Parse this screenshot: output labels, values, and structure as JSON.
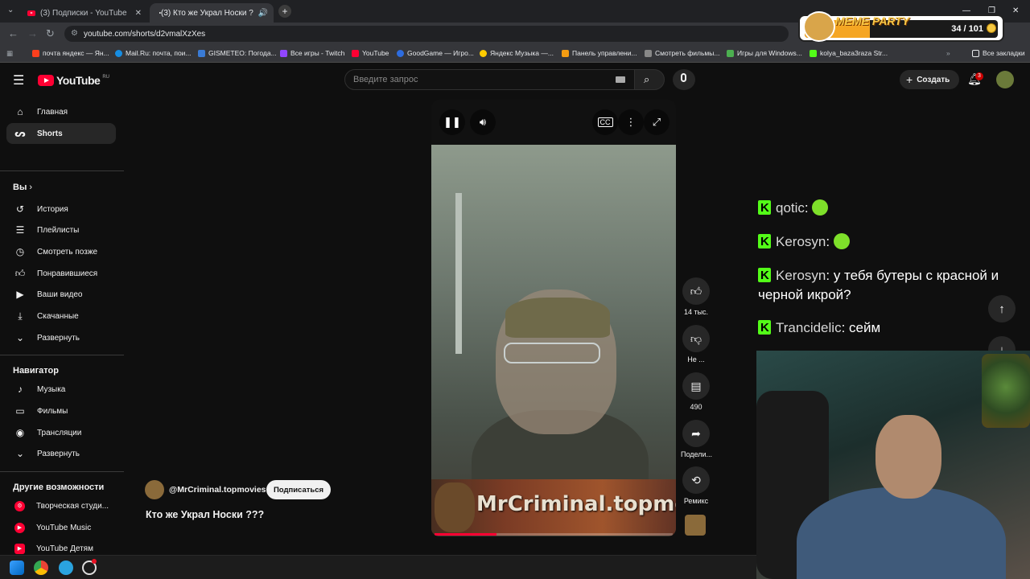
{
  "browser": {
    "tabs": [
      {
        "label": "(3) Подписки - YouTube"
      },
      {
        "label": "(3) Кто же Украл Носки ?"
      }
    ],
    "url": "youtube.com/shorts/d2vmalXzXes",
    "bookmarks": [
      "почта яндекс — Ян...",
      "Mail.Ru: почта, пои...",
      "GISMETEO: Погода...",
      "Все игры - Twitch",
      "YouTube",
      "GoodGame — Игро...",
      "Яндекс Музыка —...",
      "Панель управлени...",
      "Смотреть фильмы...",
      "Игры для Windows...",
      "kolya_baza3raza Str...",
      "Все закладки"
    ]
  },
  "overlay": {
    "title": "MEME PARTY",
    "count": "34 / 101",
    "progress": 0.337
  },
  "youtube": {
    "logo": "YouTube",
    "region": "RU",
    "search_placeholder": "Введите запрос",
    "create_label": "Создать",
    "notifications": "3"
  },
  "sidebar": {
    "main": [
      {
        "label": "Главная",
        "icon": "home-icon"
      },
      {
        "label": "Shorts",
        "icon": "shorts-icon"
      }
    ],
    "you_header": "Вы",
    "you": [
      {
        "label": "История",
        "icon": "history-icon"
      },
      {
        "label": "Плейлисты",
        "icon": "playlist-icon"
      },
      {
        "label": "Смотреть позже",
        "icon": "clock-icon"
      },
      {
        "label": "Понравившиеся",
        "icon": "thumbs-up-icon"
      },
      {
        "label": "Ваши видео",
        "icon": "video-icon"
      },
      {
        "label": "Скачанные",
        "icon": "download-icon"
      },
      {
        "label": "Развернуть",
        "icon": "chevron-down-icon"
      }
    ],
    "nav_header": "Навигатор",
    "nav": [
      {
        "label": "Музыка",
        "icon": "music-icon"
      },
      {
        "label": "Фильмы",
        "icon": "film-icon"
      },
      {
        "label": "Трансляции",
        "icon": "live-icon"
      },
      {
        "label": "Развернуть",
        "icon": "chevron-down-icon"
      }
    ],
    "more_header": "Другие возможности",
    "more": [
      {
        "label": "Творческая студи...",
        "icon": "studio-icon"
      },
      {
        "label": "YouTube Music",
        "icon": "yt-music-icon"
      },
      {
        "label": "YouTube Детям",
        "icon": "yt-kids-icon"
      }
    ]
  },
  "short": {
    "watermark": "MrCriminal.topmovie",
    "channel": "@MrCriminal.topmovies",
    "subscribe_label": "Подписаться",
    "title": "Кто же Украл Носки ???",
    "progress": 0.26,
    "actions": {
      "likes": "14 тыс.",
      "dislike": "Не ...",
      "comments": "490",
      "share": "Подели...",
      "remix": "Ремикс"
    }
  },
  "chat": [
    {
      "user": "qotic",
      "text": ""
    },
    {
      "user": "Kerosyn",
      "text": ""
    },
    {
      "user": "Kerosyn",
      "text": "у тебя бутеры с красной и черной икрой?"
    },
    {
      "user": "Trancidelic",
      "text": "сейм"
    }
  ],
  "colors": {
    "accent": "#ff0033",
    "kick_green": "#53fc18",
    "background": "#0f0f0f"
  }
}
